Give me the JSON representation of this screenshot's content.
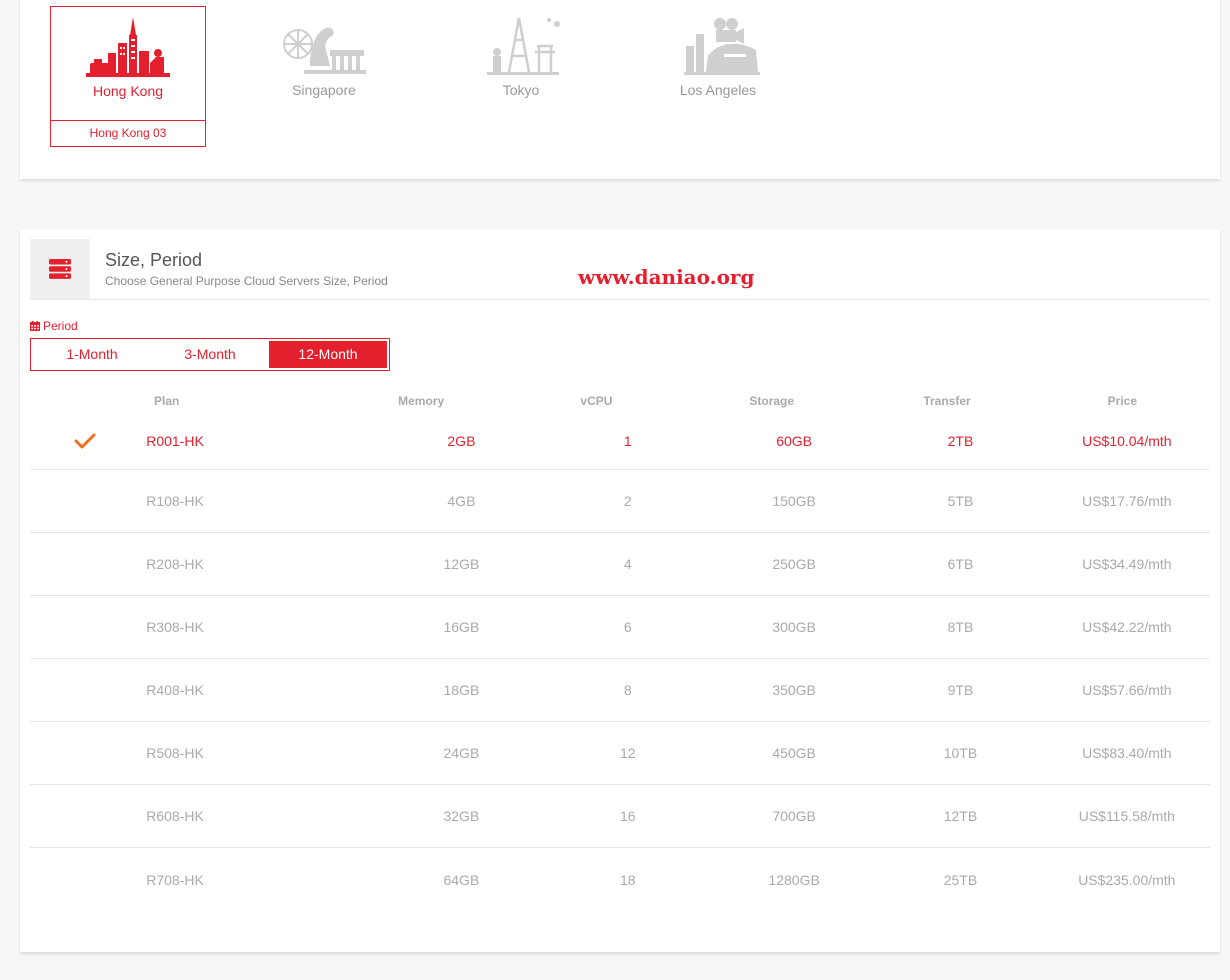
{
  "regions": [
    {
      "name": "Hong Kong",
      "icon": "hong-kong-skyline-icon",
      "active": true,
      "sub_location": "Hong Kong 03"
    },
    {
      "name": "Singapore",
      "icon": "singapore-merlion-icon",
      "active": false
    },
    {
      "name": "Tokyo",
      "icon": "tokyo-tower-icon",
      "active": false
    },
    {
      "name": "Los Angeles",
      "icon": "los-angeles-hollywood-icon",
      "active": false
    }
  ],
  "section": {
    "icon": "server-stack-icon",
    "title": "Size, Period",
    "subtitle": "Choose General Purpose Cloud Servers Size, Period"
  },
  "watermark": "www.daniao.org",
  "period": {
    "label": "Period",
    "icon": "calendar-icon",
    "tabs": [
      "1-Month",
      "3-Month",
      "12-Month"
    ],
    "selected": "12-Month"
  },
  "table": {
    "columns": [
      "Plan",
      "Memory",
      "vCPU",
      "Storage",
      "Transfer",
      "Price"
    ],
    "rows": [
      {
        "plan": "R001-HK",
        "memory": "2GB",
        "vcpu": "1",
        "storage": "60GB",
        "transfer": "2TB",
        "price": "US$10.04/mth",
        "selected": true
      },
      {
        "plan": "R108-HK",
        "memory": "4GB",
        "vcpu": "2",
        "storage": "150GB",
        "transfer": "5TB",
        "price": "US$17.76/mth",
        "selected": false
      },
      {
        "plan": "R208-HK",
        "memory": "12GB",
        "vcpu": "4",
        "storage": "250GB",
        "transfer": "6TB",
        "price": "US$34.49/mth",
        "selected": false
      },
      {
        "plan": "R308-HK",
        "memory": "16GB",
        "vcpu": "6",
        "storage": "300GB",
        "transfer": "8TB",
        "price": "US$42.22/mth",
        "selected": false
      },
      {
        "plan": "R408-HK",
        "memory": "18GB",
        "vcpu": "8",
        "storage": "350GB",
        "transfer": "9TB",
        "price": "US$57.66/mth",
        "selected": false
      },
      {
        "plan": "R508-HK",
        "memory": "24GB",
        "vcpu": "12",
        "storage": "450GB",
        "transfer": "10TB",
        "price": "US$83.40/mth",
        "selected": false
      },
      {
        "plan": "R608-HK",
        "memory": "32GB",
        "vcpu": "16",
        "storage": "700GB",
        "transfer": "12TB",
        "price": "US$115.58/mth",
        "selected": false
      },
      {
        "plan": "R708-HK",
        "memory": "64GB",
        "vcpu": "18",
        "storage": "1280GB",
        "transfer": "25TB",
        "price": "US$235.00/mth",
        "selected": false
      }
    ]
  },
  "colors": {
    "accent": "#e5202e",
    "check": "#f07020",
    "muted": "#aaaaaa"
  }
}
